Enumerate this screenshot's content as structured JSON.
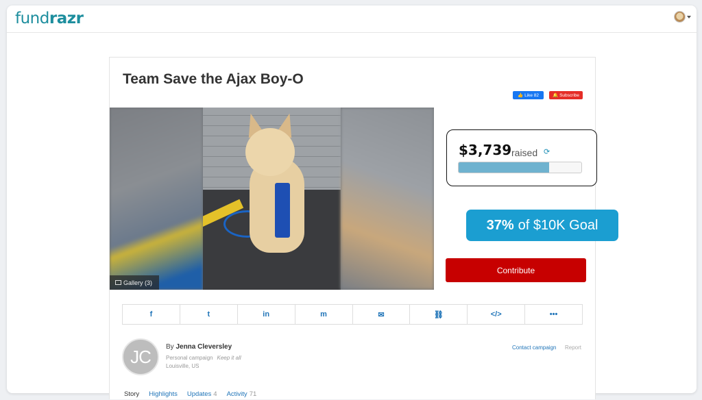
{
  "header": {
    "logo_prefix": "fund",
    "logo_suffix": "razr"
  },
  "campaign": {
    "title": "Team Save the Ajax Boy-O",
    "like_label": "Like 82",
    "subscribe_label": "Subscribe",
    "gallery_label": "Gallery (3)",
    "amount_raised": "$3,739",
    "raised_label": "raised",
    "progress_fraction": 0.74,
    "goal_percent": "37%",
    "goal_text": "of $10K Goal",
    "contribute_label": "Contribute"
  },
  "share_icons": [
    "facebook-icon",
    "twitter-icon",
    "linkedin-icon",
    "messenger-icon",
    "email-icon",
    "link-icon",
    "embed-icon",
    "more-icon"
  ],
  "share_glyphs": [
    "f",
    "t",
    "in",
    "m",
    "✉",
    "⛓",
    "</>",
    "•••"
  ],
  "owner": {
    "initials": "JC",
    "by_prefix": "By",
    "name": "Jenna Cleversley",
    "campaign_type": "Personal campaign",
    "tagline": "Keep it all",
    "location": "Louisville, US",
    "contact_label": "Contact campaign",
    "report_label": "Report"
  },
  "tabs": [
    {
      "label": "Story",
      "count": ""
    },
    {
      "label": "Highlights",
      "count": ""
    },
    {
      "label": "Updates",
      "count": "4"
    },
    {
      "label": "Activity",
      "count": "71"
    }
  ],
  "colors": {
    "brand": "#1d8e9e",
    "contribute": "#c70000",
    "goal_pill": "#1b9ed1",
    "progress": "#6fb2cf"
  }
}
